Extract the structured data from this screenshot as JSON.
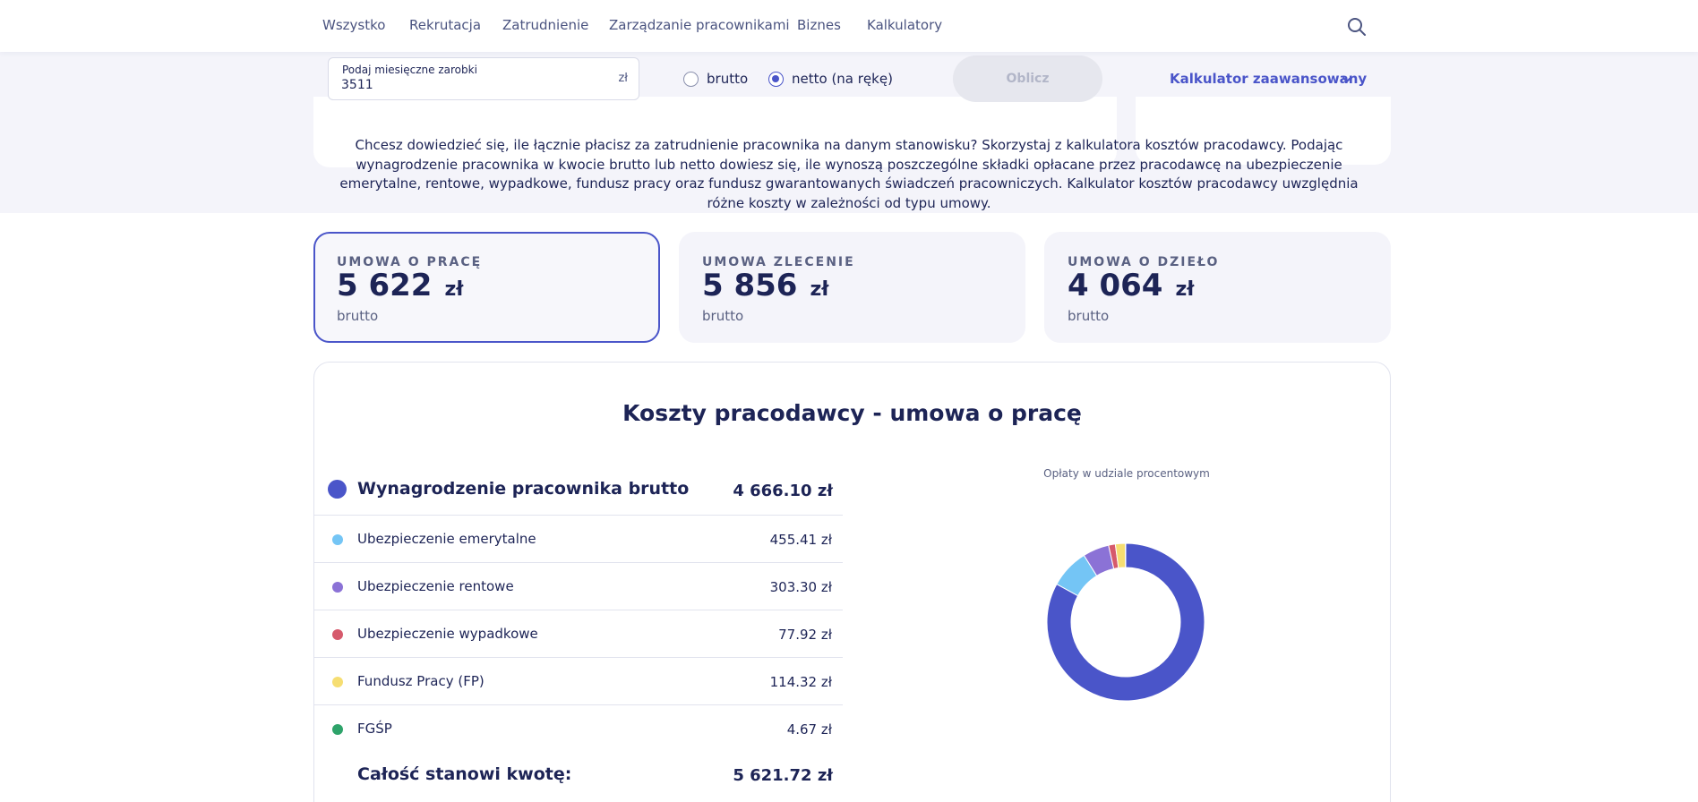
{
  "nav": {
    "items": [
      "Wszystko",
      "Rekrutacja",
      "Zatrudnienie",
      "Zarządzanie pracownikami",
      "Biznes",
      "Kalkulatory"
    ],
    "search_icon": "search-icon"
  },
  "calculator": {
    "input_label": "Podaj miesięczne zarobki",
    "input_value": "3511",
    "unit": "zł",
    "radio_brutto": "brutto",
    "radio_netto": "netto (na rękę)",
    "selected": "netto",
    "calculate_button": "Oblicz",
    "advanced_link": "Kalkulator zaawansowany",
    "advanced_icon": "chevron-down-icon"
  },
  "description": "Chcesz dowiedzieć się, ile łącznie płacisz za zatrudnienie pracownika na danym stanowisku? Skorzystaj z kalkulatora kosztów pracodawcy. Podając wynagrodzenie pracownika w kwocie brutto lub netto dowiesz się, ile wynoszą poszczególne składki opłacane przez pracodawcę na ubezpieczenie emerytalne, rentowe, wypadkowe, fundusz pracy oraz fundusz gwarantowanych świadczeń pracowniczych. Kalkulator kosztów pracodawcy uwzględnia różne koszty w zależności od typu umowy.",
  "contracts": [
    {
      "title": "UMOWA O PRACĘ",
      "amount": "5 622",
      "unit": "zł",
      "note": "brutto",
      "active": true
    },
    {
      "title": "UMOWA ZLECENIE",
      "amount": "5 856",
      "unit": "zł",
      "note": "brutto",
      "active": false
    },
    {
      "title": "UMOWA O DZIEŁO",
      "amount": "4 064",
      "unit": "zł",
      "note": "brutto",
      "active": false
    }
  ],
  "costs": {
    "title": "Koszty pracodawcy - umowa o pracę",
    "main": {
      "label": "Wynagrodzenie pracownika brutto",
      "value": "4 666.10 zł",
      "color": "#4a55c9",
      "amount": 4666.1
    },
    "items": [
      {
        "label": "Ubezpieczenie emerytalne",
        "value": "455.41 zł",
        "color": "#74c5f5",
        "amount": 455.41
      },
      {
        "label": "Ubezpieczenie rentowe",
        "value": "303.30 zł",
        "color": "#8b72d6",
        "amount": 303.3
      },
      {
        "label": "Ubezpieczenie wypadkowe",
        "value": "77.92 zł",
        "color": "#d65a6c",
        "amount": 77.92
      },
      {
        "label": "Fundusz Pracy (FP)",
        "value": "114.32 zł",
        "color": "#f6de72",
        "amount": 114.32
      },
      {
        "label": "FGŚP",
        "value": "4.67 zł",
        "color": "#2ea36a",
        "amount": 4.67
      }
    ],
    "total_label": "Całość stanowi kwotę:",
    "total_value": "5 621.72 zł",
    "chart_caption": "Opłaty w udziale procentowym"
  }
}
